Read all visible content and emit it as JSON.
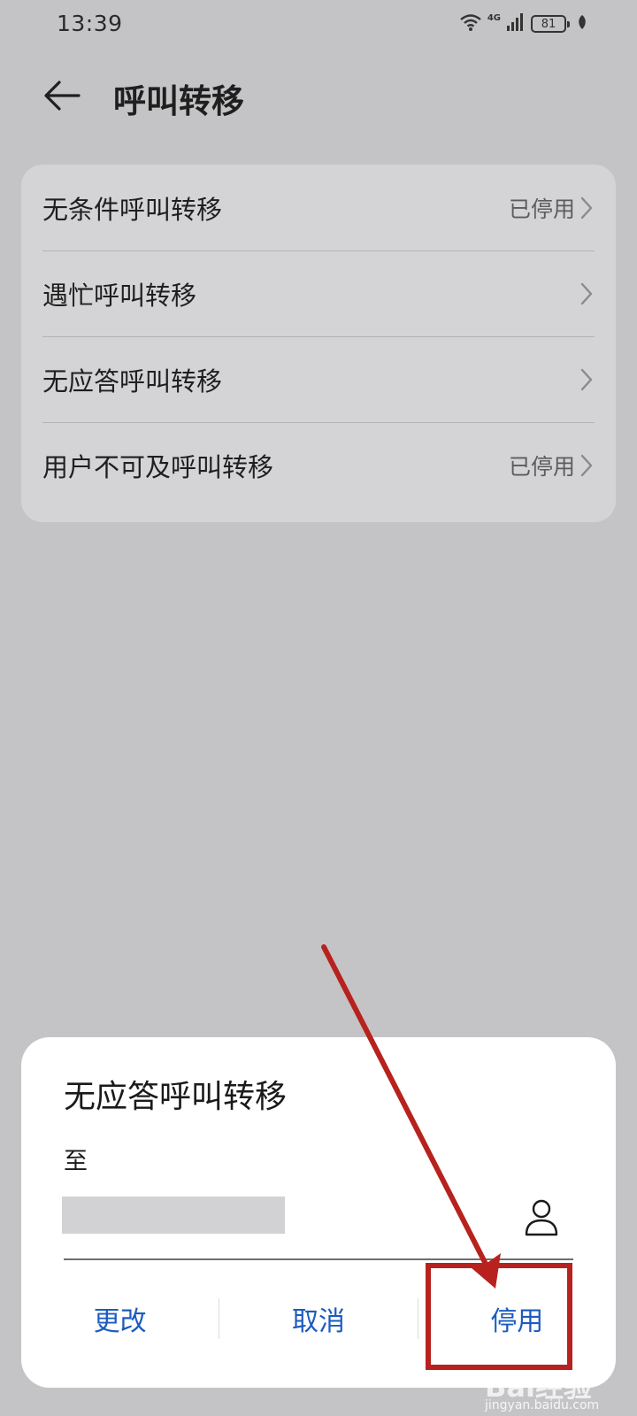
{
  "status_bar": {
    "time": "13:39",
    "network": "4G",
    "battery": "81",
    "icons": [
      "wifi-icon",
      "signal-icon",
      "battery-icon",
      "leaf-icon"
    ]
  },
  "header": {
    "back_icon": "arrow-left-icon",
    "title": "呼叫转移"
  },
  "settings": {
    "items": [
      {
        "label": "无条件呼叫转移",
        "status": "已停用"
      },
      {
        "label": "遇忙呼叫转移",
        "status": ""
      },
      {
        "label": "无应答呼叫转移",
        "status": ""
      },
      {
        "label": "用户不可及呼叫转移",
        "status": "已停用"
      }
    ]
  },
  "dialog": {
    "title": "无应答呼叫转移",
    "to_label": "至",
    "contact_icon": "person-icon",
    "buttons": {
      "change": "更改",
      "cancel": "取消",
      "disable": "停用"
    },
    "button_color": "#1c5bbf"
  },
  "annotation": {
    "color": "#b8221e",
    "marks": [
      "red-arrow",
      "highlight-box"
    ]
  },
  "watermark": {
    "logo": "Bai经验",
    "url": "jingyan.baidu.com"
  }
}
